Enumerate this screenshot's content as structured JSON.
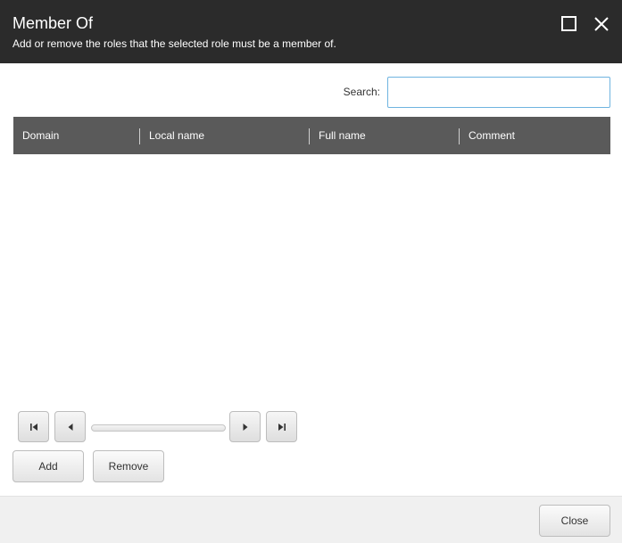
{
  "dialog": {
    "title": "Member Of",
    "subtitle": "Add or remove the roles that the selected role must be a member of.",
    "maximize_icon": "maximize-icon",
    "close_icon": "close-icon"
  },
  "search": {
    "label": "Search:",
    "value": "",
    "placeholder": ""
  },
  "grid": {
    "columns": [
      {
        "label": "Domain"
      },
      {
        "label": "Local name"
      },
      {
        "label": "Full name"
      },
      {
        "label": "Comment"
      }
    ],
    "rows": []
  },
  "pager": {
    "first_icon": "first-page-icon",
    "prev_icon": "previous-page-icon",
    "next_icon": "next-page-icon",
    "last_icon": "last-page-icon"
  },
  "actions": {
    "add_label": "Add",
    "remove_label": "Remove"
  },
  "footer": {
    "close_label": "Close"
  }
}
